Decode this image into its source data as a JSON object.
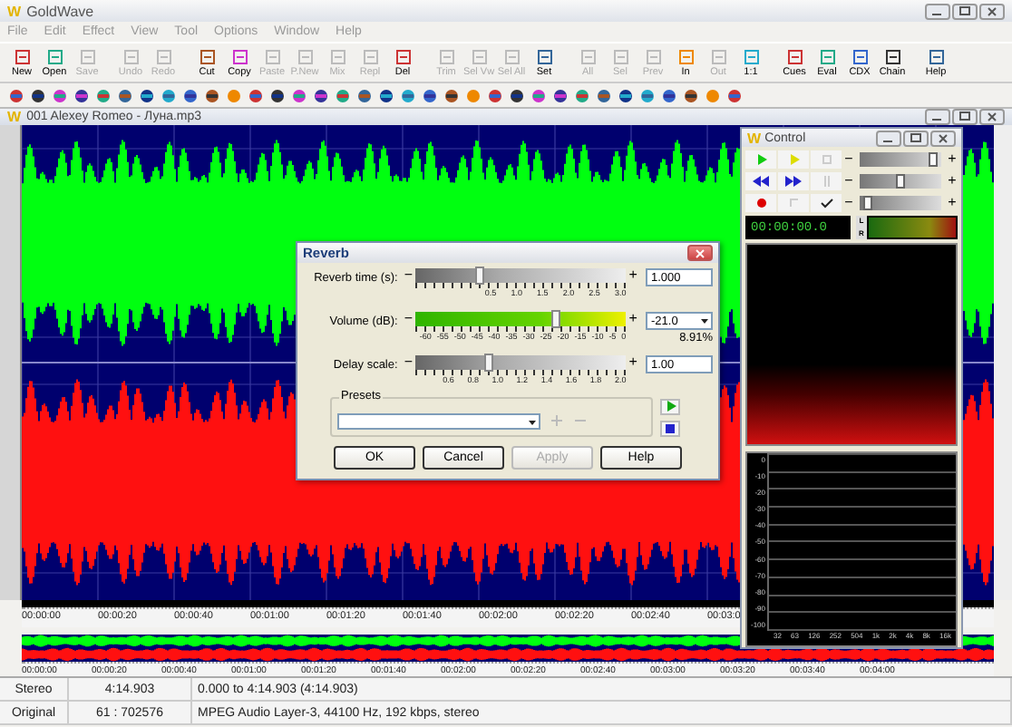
{
  "window": {
    "logo": "W",
    "title": "GoldWave"
  },
  "menu": [
    "File",
    "Edit",
    "Effect",
    "View",
    "Tool",
    "Options",
    "Window",
    "Help"
  ],
  "toolbar": [
    {
      "label": "New",
      "disabled": false
    },
    {
      "label": "Open",
      "disabled": false
    },
    {
      "label": "Save",
      "disabled": true
    },
    {
      "label": "Undo",
      "disabled": true
    },
    {
      "label": "Redo",
      "disabled": true
    },
    {
      "label": "Cut",
      "disabled": false
    },
    {
      "label": "Copy",
      "disabled": false
    },
    {
      "label": "Paste",
      "disabled": true
    },
    {
      "label": "P.New",
      "disabled": true
    },
    {
      "label": "Mix",
      "disabled": true
    },
    {
      "label": "Repl",
      "disabled": true
    },
    {
      "label": "Del",
      "disabled": false
    },
    {
      "label": "Trim",
      "disabled": true
    },
    {
      "label": "Sel Vw",
      "disabled": true
    },
    {
      "label": "Sel All",
      "disabled": true
    },
    {
      "label": "Set",
      "disabled": false
    },
    {
      "label": "All",
      "disabled": true
    },
    {
      "label": "Sel",
      "disabled": true
    },
    {
      "label": "Prev",
      "disabled": true
    },
    {
      "label": "In",
      "disabled": false
    },
    {
      "label": "Out",
      "disabled": true
    },
    {
      "label": "1:1",
      "disabled": false
    },
    {
      "label": "Cues",
      "disabled": false
    },
    {
      "label": "Eval",
      "disabled": false
    },
    {
      "label": "CDX",
      "disabled": false
    },
    {
      "label": "Chain",
      "disabled": false
    },
    {
      "label": "Help",
      "disabled": false
    }
  ],
  "document": {
    "logo": "W",
    "title": "001 Alexey Romeo - Луна.mp3",
    "timeline": [
      "00:00:00",
      "00:00:20",
      "00:00:40",
      "00:01:00",
      "00:01:20",
      "00:01:40",
      "00:02:00",
      "00:02:20",
      "00:02:40",
      "00:03:0"
    ],
    "overview_timeline": [
      "00:00:00",
      "00:00:20",
      "00:00:40",
      "00:01:00",
      "00:01:20",
      "00:01:40",
      "00:02:00",
      "00:02:20",
      "00:02:40",
      "00:03:00",
      "00:03:20",
      "00:03:40",
      "00:04:00"
    ]
  },
  "reverb_dialog": {
    "title": "Reverb",
    "decrease_label": "−",
    "increase_label": "+",
    "params": [
      {
        "label": "Reverb time (s):",
        "kind": "spin",
        "level": 0.3,
        "value": "1.000",
        "ticks": [
          "0.5",
          "1.0",
          "1.5",
          "2.0",
          "2.5",
          "3.0"
        ]
      },
      {
        "label": "Volume (dB):",
        "kind": "dropdown",
        "level": 0.66,
        "value": "-21.0",
        "note": "8.91%",
        "ticks": [
          "-60",
          "-55",
          "-50",
          "-45",
          "-40",
          "-35",
          "-30",
          "-25",
          "-20",
          "-15",
          "-10",
          "-5",
          "0"
        ]
      },
      {
        "label": "Delay scale:",
        "kind": "spin",
        "level": 0.34,
        "value": "1.00",
        "ticks": [
          "0.6",
          "0.8",
          "1.0",
          "1.2",
          "1.4",
          "1.6",
          "1.8",
          "2.0"
        ]
      }
    ],
    "presets_label": "Presets",
    "buttons": [
      {
        "label": "OK",
        "disabled": false
      },
      {
        "label": "Cancel",
        "disabled": false
      },
      {
        "label": "Apply",
        "disabled": true
      },
      {
        "label": "Help",
        "disabled": false
      }
    ]
  },
  "control": {
    "logo": "W",
    "title": "Control",
    "decrease_label": "−",
    "increase_label": "+",
    "time": "00:00:00.0",
    "meter_labels": [
      "L",
      "R"
    ],
    "sliders": [
      {
        "level": 0.9
      },
      {
        "level": 0.5
      },
      {
        "level": 0.12
      }
    ],
    "db_labels": [
      "0",
      "-10",
      "-20",
      "-30",
      "-40",
      "-50",
      "-60",
      "-70",
      "-80",
      "-90",
      "-100"
    ],
    "freq_labels": [
      "32",
      "63",
      "126",
      "252",
      "504",
      "1k",
      "2k",
      "4k",
      "8k",
      "16k"
    ]
  },
  "status_bar": [
    [
      "Stereo",
      "4:14.903",
      "0.000 to 4:14.903 (4:14.903)"
    ],
    [
      "Original",
      "61 : 702576",
      "MPEG Audio Layer-3, 44100 Hz, 192 kbps, stereo"
    ]
  ]
}
